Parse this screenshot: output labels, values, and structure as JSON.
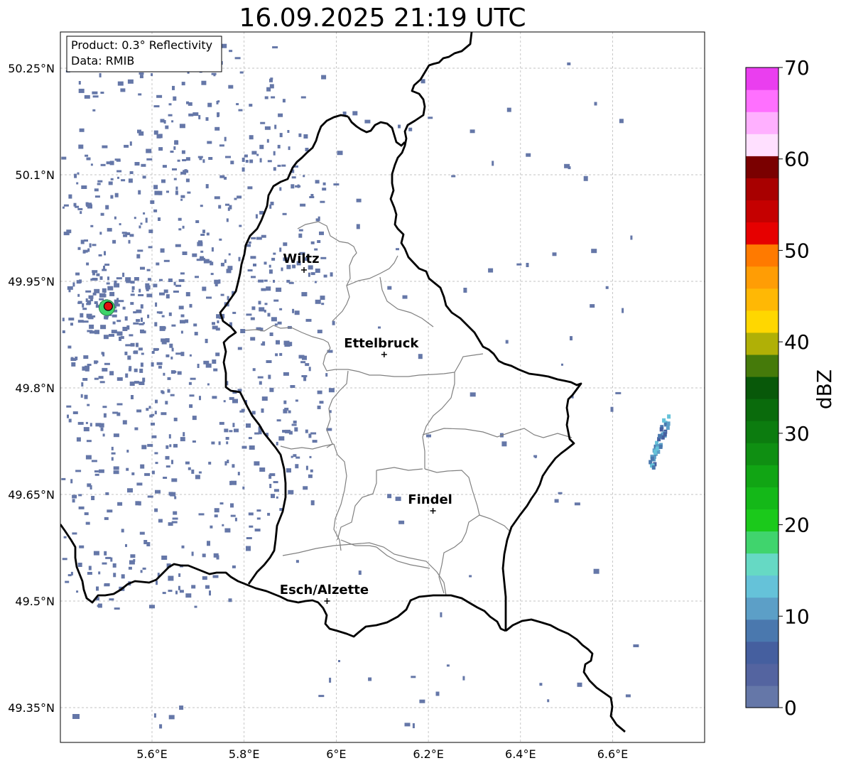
{
  "title": "16.09.2025 21:19 UTC",
  "info_box": {
    "product": "Product: 0.3° Reflectivity",
    "data": "Data: RMIB"
  },
  "map": {
    "lon_range": [
      5.4,
      6.8
    ],
    "lat_range": [
      49.3,
      50.3
    ],
    "lat_ticks": [
      "49.35°N",
      "49.5°N",
      "49.65°N",
      "49.8°N",
      "49.95°N",
      "50.1°N",
      "50.25°N"
    ],
    "lat_tick_values": [
      49.35,
      49.5,
      49.65,
      49.8,
      49.95,
      50.1,
      50.25
    ],
    "lon_ticks": [
      "5.6°E",
      "5.8°E",
      "6°E",
      "6.2°E",
      "6.4°E",
      "6.6°E"
    ],
    "lon_tick_values": [
      5.6,
      5.8,
      6.0,
      6.2,
      6.4,
      6.6
    ],
    "gridlines": true,
    "cities": [
      {
        "name": "Wiltz",
        "lon": 5.93,
        "lat": 49.966
      },
      {
        "name": "Ettelbruck",
        "lon": 6.104,
        "lat": 49.847
      },
      {
        "name": "Findel",
        "lon": 6.21,
        "lat": 49.627
      },
      {
        "name": "Esch/Alzette",
        "lon": 5.98,
        "lat": 49.5
      }
    ],
    "radar_site": {
      "lon": 5.505,
      "lat": 49.915,
      "color": "#e01010"
    },
    "echo_color": "#6577a8"
  },
  "colorbar": {
    "label": "dBZ",
    "min": 0,
    "max": 70,
    "ticks": [
      "0",
      "10",
      "20",
      "30",
      "40",
      "50",
      "60",
      "70"
    ],
    "colors": [
      "#6577a8",
      "#5464a0",
      "#455f9f",
      "#4a78ae",
      "#5c9fc7",
      "#65c2d9",
      "#66d9c4",
      "#40d46d",
      "#1bc91b",
      "#14b818",
      "#11a514",
      "#0f8f12",
      "#0c7c0f",
      "#0a6b0c",
      "#085809",
      "#457a0a",
      "#b0b006",
      "#ffd700",
      "#ffb805",
      "#ff9d05",
      "#ff7a00",
      "#e60000",
      "#c50000",
      "#a80000",
      "#7a0000",
      "#ffe0ff",
      "#ffb0ff",
      "#ff70ff",
      "#ea3eef"
    ]
  }
}
